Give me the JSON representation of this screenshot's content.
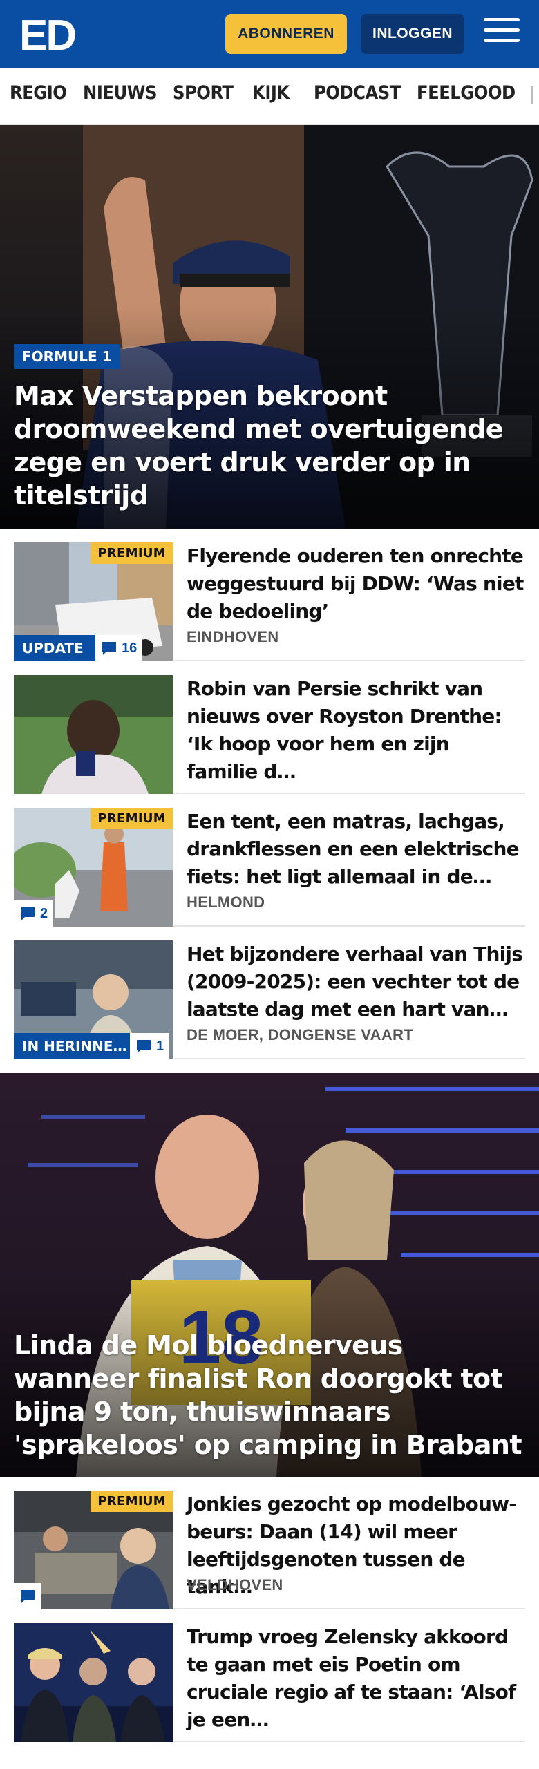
{
  "header": {
    "logo_text": "ED",
    "subscribe_label": "ABONNEREN",
    "login_label": "INLOGGEN"
  },
  "nav": {
    "items": [
      "REGIO",
      "NIEUWS",
      "SPORT",
      "KIJK",
      "PODCAST",
      "FEELGOOD"
    ]
  },
  "hero": {
    "badge": "FORMULE 1",
    "title": "Max Verstappen bekroont droomweekend met overtuigende zege en voert druk verder op in titel­strijd"
  },
  "articles": [
    {
      "premium": "PREMIUM",
      "tag": "UPDATE",
      "comments": "16",
      "title": "Flyerende ouderen ten onrechte weggestuurd bij DDW: ‘Was niet de bedoeling’",
      "location": "EINDHOVEN"
    },
    {
      "title": "Robin van Persie schrikt van nieuws over Royston Drenthe: ‘Ik hoop voor hem en zijn familie d…"
    },
    {
      "premium": "PREMIUM",
      "comments": "2",
      "title": "Een tent, een matras, lachgas, drankflessen en een elektrische fiets: het ligt allemaal in de…",
      "location": "HELMOND"
    },
    {
      "tag": "IN HERINNE…",
      "comments": "1",
      "title": "Het bijzondere verhaal van Thijs (2009-2025): een vechter tot de laatste dag met een hart van…",
      "location": "DE MOER, DONGENSE VAART"
    },
    {
      "premium": "PREMIUM",
      "title": "Jonkies gezocht op modelbouw­beurs: Daan (14) wil meer leeftijdsgenoten tussen de tank…",
      "location": "VELDHOVEN"
    },
    {
      "title": "Trump vroeg Zelensky akkoord te gaan met eis Poetin om cruciale regio af te staan: ‘Alsof je een…"
    }
  ],
  "hero2": {
    "podium_number": "18",
    "title": "Linda de Mol bloednerveus wanneer finalist Ron doorgokt tot bijna 9 ton, thuiswinnaars 'sprakeloos' op camping in Brabant"
  },
  "icons": {
    "comment": "comment-bubble-icon",
    "menu": "hamburger-menu-icon"
  },
  "colors": {
    "brand_blue": "#0a4ea3",
    "subscribe_yellow": "#f5c13a",
    "premium_yellow": "#f5c13a"
  }
}
